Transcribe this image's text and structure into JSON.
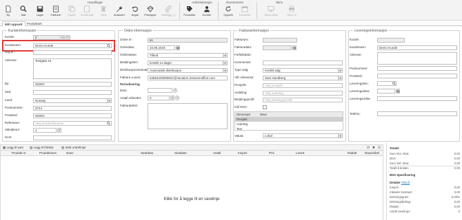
{
  "ribbon": {
    "groups": {
      "handlinger": "Handlinger",
      "administrasjon": "Administrasjon",
      "abonnement": "Abonnement",
      "skriv": "Skriv"
    },
    "buttons": {
      "ny": "Ny",
      "sok": "Søk",
      "lagre": "Lagre",
      "faktura": "Fakturer",
      "kopier": "Kopier",
      "kreditnota": "Kreditnota",
      "slett": "Slett",
      "avansert": "Avansert",
      "angre": "Angre",
      "prisvipper": "Prisvipper",
      "vedlegg": "Vedlegg (..)",
      "produkter": "Produkter",
      "kunder": "Kunder",
      "opprett": "Opprett",
      "kanseller": "Kanseller",
      "send_ordre": "Send ordre",
      "skriv_ut": "Skriv ut"
    }
  },
  "tabs": [
    "Mitt oppsett",
    "Produktark"
  ],
  "kunde": {
    "title": "Kundeinformasjon",
    "kunde_label": "Kunde:",
    "kunde_value": "0",
    "kundenavn_label": "Kundenavn:",
    "kundenavn_value": "Demo Kunde",
    "orgnr_label": "Org.nr.:",
    "adresse_label": "Adresse:",
    "adresse_value": "Testgata 10",
    "by_label": "By:",
    "by_value": "SKIEN",
    "stat_label": "Stat:",
    "land_label": "Land:",
    "land_value": "Norway",
    "postnummer_label": "Postnummer:",
    "postnummer_value": "3744",
    "poststed_label": "Poststed:",
    "poststed_value": "SKIEN",
    "referanse_label": "Referanse:",
    "referanse_placeholder": "Velg kundereferanse",
    "valutakurs_label": "Valutakurs:",
    "valutakurs_value": "1",
    "gln_label": "GLN:"
  },
  "ordre": {
    "title": "Ordre informasjon",
    "ordrenr_label": "Ordre nr:",
    "ordrenr_value": "61",
    "ordredato_label": "Ordredato:",
    "ordredato_value": "10.05.2019",
    "ordrestatus_label": "Ordrestatus:",
    "ordrestatus_value": "Tilbud",
    "betalingsbet_label": "Betalingsbet.:",
    "betalingsbet_value": "Kreditt 14 dager",
    "distribusjon_label": "Distribusjonsmetode:",
    "distribusjon_value": "Automatisk distribusjon",
    "faktura_epost_label": "Faktura e-post:",
    "faktura_epost_value": "54553430909021@vacation.24sevenoffice.com",
    "periodisering_label": "Periodisering",
    "dato_label": "Dato:",
    "antall_mnd_label": "Antall måneder:",
    "antall_mnd_value": "0",
    "fakturatekst_label": "Fakturatekst:"
  },
  "faktura": {
    "title": "Fakturainformasjon",
    "fakturanr_label": "Fakturanr.:",
    "fakturadato_label": "Fakturadato:",
    "forfallsdato_label": "Forfallsdato:",
    "kommentar_label": "Kommentar:",
    "type_salg_label": "Type salg:",
    "type_salg_value": "Kreditt salg",
    "var_ref_label": "Vår referanse:",
    "var_ref_value": "Sara Sandberg",
    "prosjekt_label": "Prosjekt:",
    "prosjekt_placeholder": "Velg prosjekt",
    "avdeling_label": "Avdeling:",
    "avdeling_placeholder": "Velg avdeling",
    "betalingsprofil_label": "Betalingsprofil:",
    "betalingsprofil_placeholder": "Velg betalingsprofile",
    "inkl_mva_label": "Inkl MVA:",
    "dim_headers": [
      "Dimensjon",
      "Navn"
    ],
    "dim_rows": [
      "Prosjekt",
      "Avdeling",
      "Test"
    ],
    "valuta_label": "Valuta:",
    "valuta_value": "Lokal"
  },
  "levering": {
    "title": "Leveringsinformasjon",
    "kunde_label": "Kunde:",
    "kundenavn_label": "Kundenavn:",
    "kundenavn_value": "Demo Kunde",
    "adresse_label": "Adresse:",
    "postnummer_label": "Postnummer:",
    "poststed_label": "Poststed:",
    "leveringsbet_label": "Leveringsbet.:",
    "leveringsdato_label": "Leveringsdato:",
    "leveringsmate_label": "Leveringsmåte:",
    "telefon_label": "Telefon:"
  },
  "lines_toolbar": {
    "legg_til_vare": "Legg til vare",
    "legg_til_fritekst": "Legg til fritekst",
    "slett_ordrelinjer": "Slett ordrelinjer"
  },
  "grid": {
    "columns": [
      "Produkt nr",
      "Produktnavn",
      "Navn",
      "Startdato",
      "Sluttdato",
      "Antall",
      "Innpris",
      "Pris",
      "Levert",
      "Rabatt",
      "Disponibel"
    ],
    "empty_message": "Klikk for å legge til en varelinje"
  },
  "totals": {
    "title": "Totaler",
    "rows": [
      {
        "label": "Sum eks. Mva:",
        "value": "0,00"
      },
      {
        "label": "MVA:",
        "value": "0,00"
      },
      {
        "label": "Sum inkl. Mva:",
        "value": "0,00"
      },
      {
        "label": "Totalt å betale:",
        "value": "0,00"
      }
    ],
    "split_title": "MVA Spesifisering",
    "details_title": "Detaljer",
    "details_link": "(Skjul)",
    "details": [
      {
        "label": "Innpris:",
        "value": "0,00"
      },
      {
        "label": "Inklusivt kostnad:",
        "value": "0,00"
      },
      {
        "label": "Dekningsgrad:",
        "value": "0,00%"
      },
      {
        "label": "Dekningsbidrag:",
        "value": "0,00"
      },
      {
        "label": "Rabatt:",
        "value": "0,00"
      },
      {
        "label": "Antall varelinjer:",
        "value": "0"
      }
    ]
  },
  "colors": {
    "accent": "#1e88c8",
    "highlight": "#e03838",
    "ribbon_bg": "#f3f3f3"
  }
}
